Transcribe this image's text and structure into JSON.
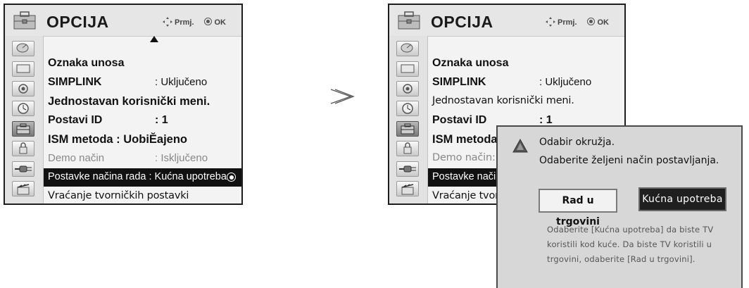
{
  "left_menu": {
    "title": "OPCIJA",
    "nav_move": "Prmj.",
    "nav_ok": "OK",
    "items": [
      {
        "label": "Oznaka unosa",
        "value": ""
      },
      {
        "label": "SIMPLINK",
        "value": ": Uključeno"
      },
      {
        "label": "Jednostavan korisnički meni.",
        "value": ""
      },
      {
        "label": "Postavi ID",
        "value": ": 1"
      },
      {
        "label": "ISM metoda : UobiĔajeno",
        "value": ""
      },
      {
        "label": "Demo način",
        "value": ": Isključeno"
      },
      {
        "label": "Postavke načina rada : Kućna upotreba",
        "value": ""
      },
      {
        "label": "Vraćanje tvorničkih postavki",
        "value": ""
      }
    ]
  },
  "separator": "≫",
  "right_menu": {
    "title": "OPCIJA",
    "nav_move": "Prmj.",
    "nav_ok": "OK",
    "items": [
      {
        "label": "Oznaka unosa",
        "value": ""
      },
      {
        "label": "SIMPLINK",
        "value": ": Uključeno"
      },
      {
        "label": "Jednostavan korisnički meni.",
        "value": ""
      },
      {
        "label": "Postavi ID",
        "value": ": 1"
      },
      {
        "label": "ISM metoda",
        "value": ""
      },
      {
        "label": "Demo način:",
        "value": ""
      },
      {
        "label": "Postavke nači",
        "value": ""
      },
      {
        "label": "Vraćanje tvor",
        "value": ""
      }
    ]
  },
  "dialog": {
    "title": "Odabir okružja.",
    "subtitle": "Odaberite željeni način postavljanja.",
    "store_button": "Rad u trgovini",
    "home_button": "Kućna upotreba",
    "note": "Odaberite [Kućna upotreba] da biste TV koristili kod kuće. Da biste TV koristili u trgovini, odaberite [Rad u trgovini]."
  },
  "icons": [
    "toolbox-icon",
    "satellite-dish-icon",
    "monitor-icon",
    "speaker-icon",
    "clock-icon",
    "toolbox-icon",
    "lock-icon",
    "plug-icon",
    "clapperboard-icon"
  ],
  "colors": {
    "selected_row": "#111111",
    "menu_bg": "#f3f3f3",
    "dialog_bg": "#d7d7d7"
  }
}
